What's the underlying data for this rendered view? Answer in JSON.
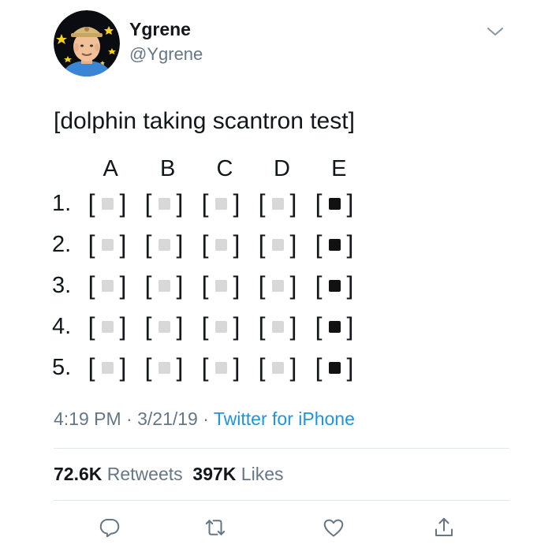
{
  "tweet": {
    "display_name": "Ygrene",
    "handle": "@Ygrene",
    "text": "[dolphin taking scantron test]",
    "time": "4:19 PM",
    "date": "3/21/19",
    "separator": "·",
    "source": "Twitter for iPhone"
  },
  "scantron": {
    "columns": [
      "A",
      "B",
      "C",
      "D",
      "E"
    ],
    "rows": [
      {
        "label": "1.",
        "filled": "E"
      },
      {
        "label": "2.",
        "filled": "E"
      },
      {
        "label": "3.",
        "filled": "E"
      },
      {
        "label": "4.",
        "filled": "E"
      },
      {
        "label": "5.",
        "filled": "E"
      }
    ]
  },
  "stats": {
    "retweets_count": "72.6K",
    "retweets_label": "Retweets",
    "likes_count": "397K",
    "likes_label": "Likes"
  },
  "icons": {
    "more": "chevron-down-icon",
    "reply": "reply-icon",
    "retweet": "retweet-icon",
    "like": "heart-icon",
    "share": "share-icon"
  },
  "colors": {
    "text": "#14171a",
    "secondary": "#657786",
    "link": "#1b95e0",
    "divider": "#e1e8ed",
    "empty_bubble": "#d8d8d8",
    "filled_bubble": "#111111"
  }
}
